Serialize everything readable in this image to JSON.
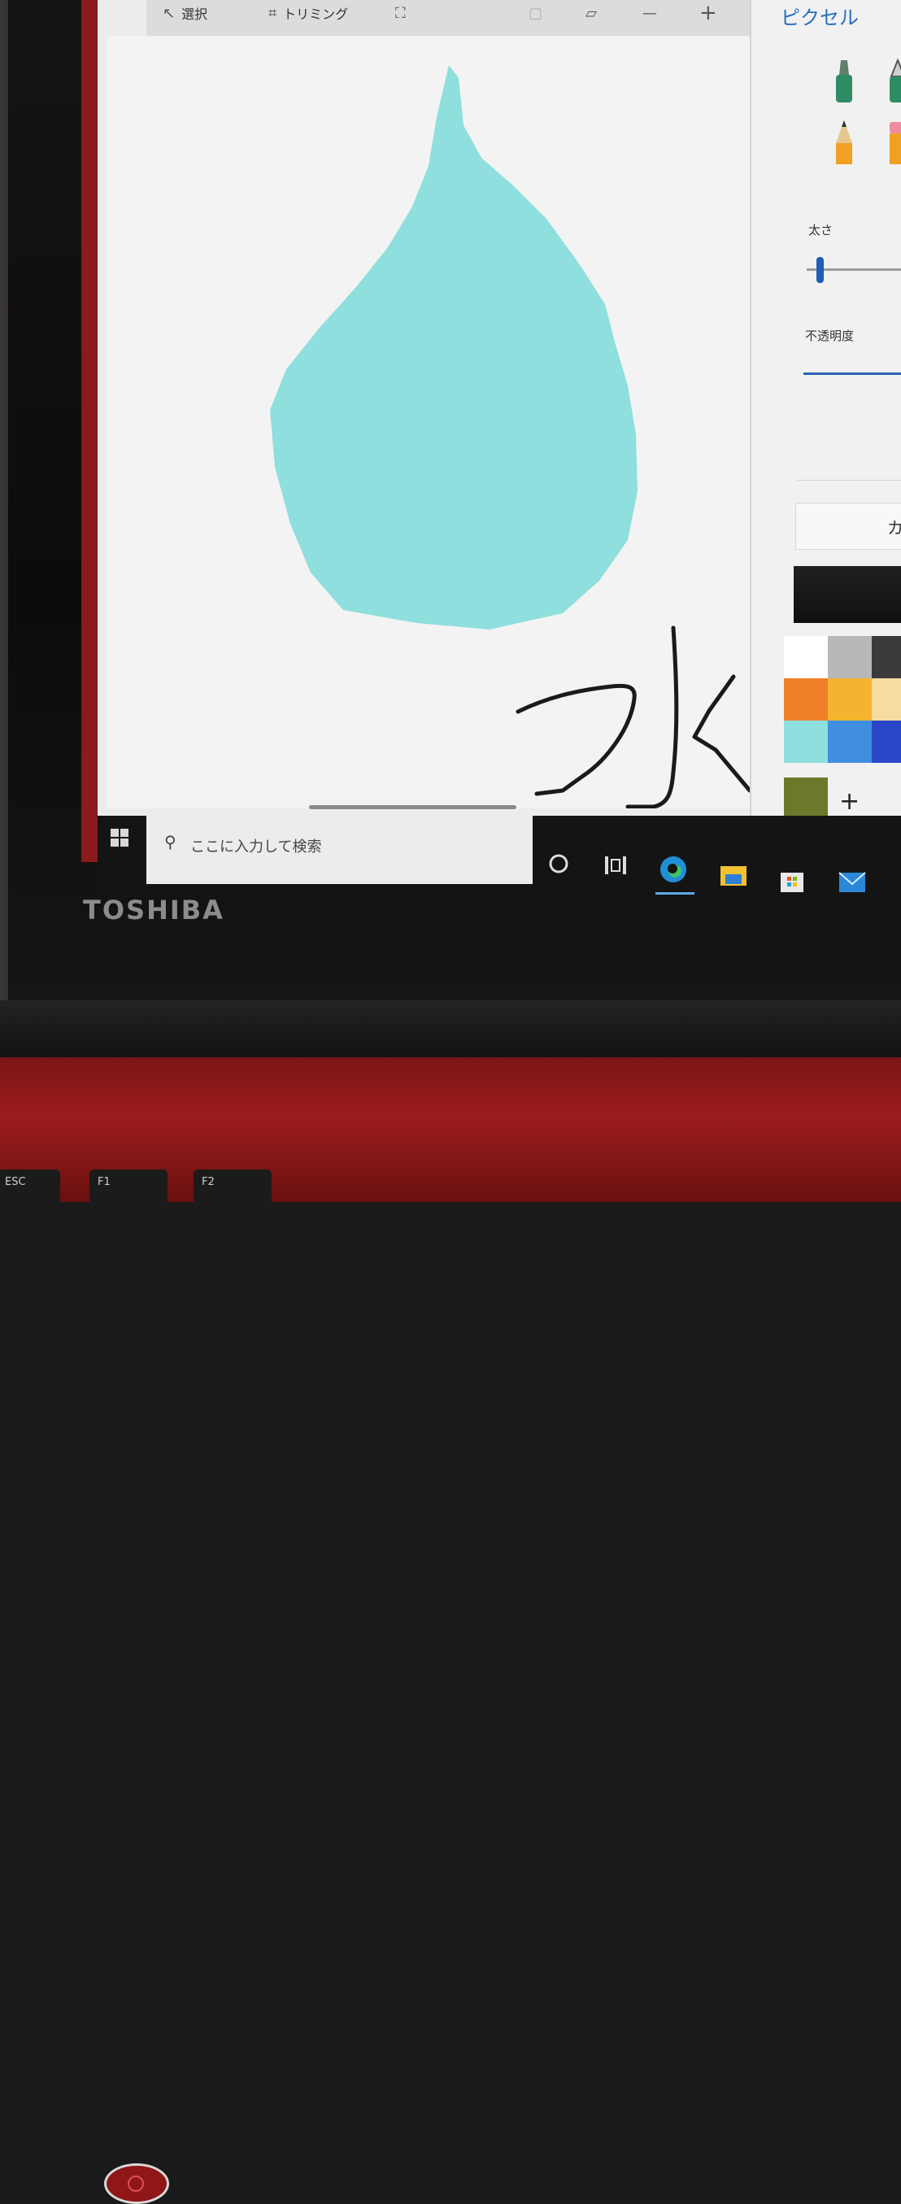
{
  "toolbar": {
    "select_label": "選択",
    "trim_label": "トリミング"
  },
  "side_panel": {
    "title": "ピクセル",
    "thickness_label": "太さ",
    "opacity_label": "不透明度",
    "color_button_label": "カ",
    "add_label": "+"
  },
  "canvas": {
    "handwritten_text": "水",
    "drop_color": "#8edfdd"
  },
  "palette": {
    "colors": [
      "#ffffff",
      "#b8b8b8",
      "#3a3a3a",
      "#ef7f29",
      "#f4b42f",
      "#f6dca0",
      "#8edfdd",
      "#3f8ee0",
      "#2b47c8"
    ],
    "custom_color": "#6b7a2a"
  },
  "taskbar": {
    "search_placeholder": "ここに入力して検索"
  },
  "device": {
    "brand": "TOSHIBA",
    "keys": [
      "ESC",
      "F1",
      "F2"
    ]
  }
}
